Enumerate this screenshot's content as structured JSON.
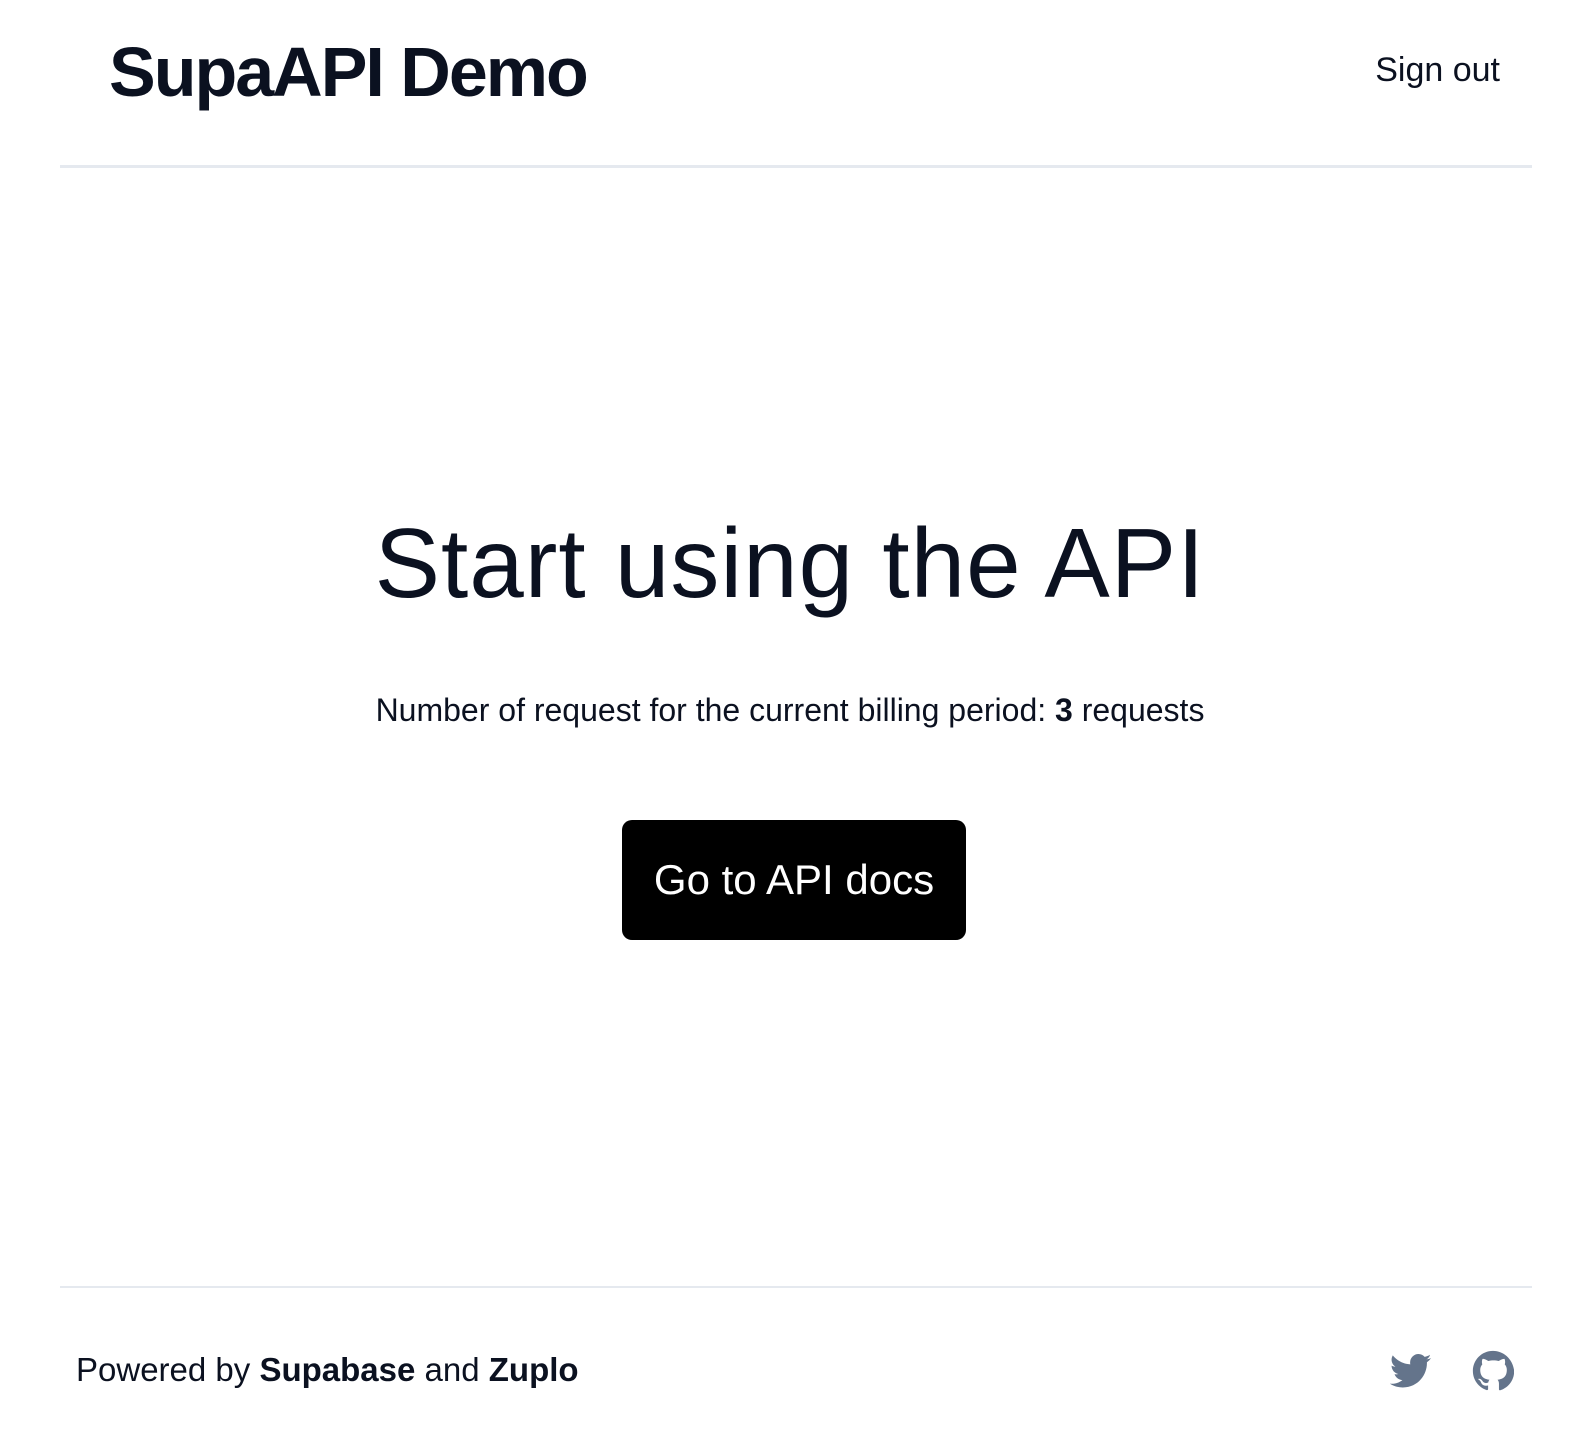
{
  "header": {
    "brand": "SupaAPI Demo",
    "sign_out_label": "Sign out"
  },
  "main": {
    "title": "Start using the API",
    "usage_prefix": "Number of request for the current billing period: ",
    "usage_count": "3",
    "usage_suffix": " requests",
    "docs_button_label": "Go to API docs"
  },
  "footer": {
    "powered_prefix": "Powered by ",
    "powered_supabase": "Supabase",
    "powered_and": " and ",
    "powered_zuplo": "Zuplo",
    "social_icons": [
      "twitter-icon",
      "github-icon"
    ]
  },
  "colors": {
    "text": "#0b1120",
    "button_bg": "#000000",
    "button_text": "#ffffff",
    "divider": "#e5e9ef",
    "icon": "#64748b"
  }
}
